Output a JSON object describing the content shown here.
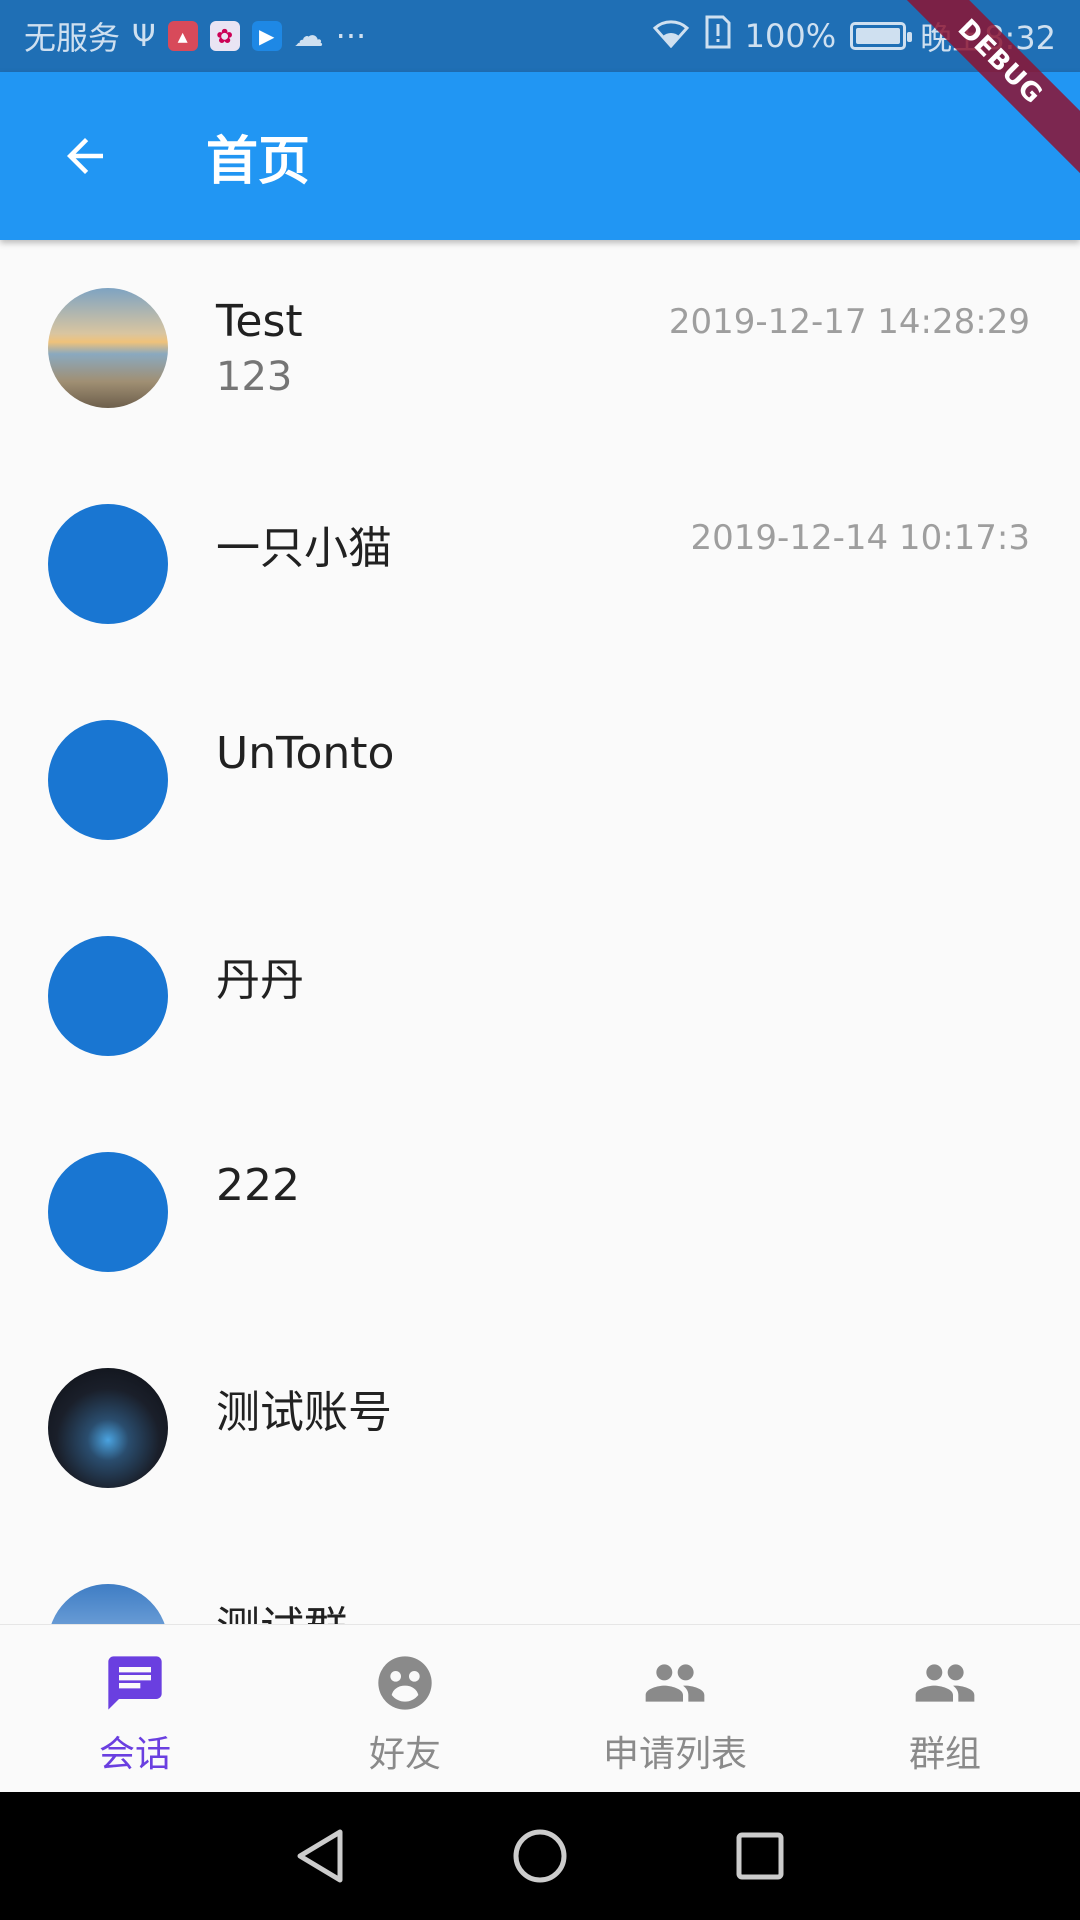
{
  "status_bar": {
    "carrier": "无服务",
    "battery": "100%",
    "battery_level": 1.0,
    "time": "晚上8:32",
    "overflow": "···"
  },
  "app_bar": {
    "title": "首页",
    "back_icon": "arrow-back-icon"
  },
  "debug_banner": "DEBUG",
  "conversations": [
    {
      "name": "Test",
      "message": "123",
      "time": "2019-12-17 14:28:29",
      "avatar": "photo-sunset"
    },
    {
      "name": "一只小猫",
      "message": "",
      "time": "2019-12-14 10:17:3",
      "avatar": "blue-circle"
    },
    {
      "name": "UnTonto",
      "message": "",
      "time": "",
      "avatar": "blue-circle"
    },
    {
      "name": "丹丹",
      "message": "",
      "time": "",
      "avatar": "blue-circle"
    },
    {
      "name": "222",
      "message": "",
      "time": "",
      "avatar": "blue-circle"
    },
    {
      "name": "测试账号",
      "message": "",
      "time": "",
      "avatar": "photo-city-night"
    },
    {
      "name": "测试群",
      "message": "",
      "time": "",
      "avatar": "photo-mountain"
    }
  ],
  "bottom_nav": {
    "active_color": "#6a3fe0",
    "inactive_color": "#8a8a8a",
    "items": [
      {
        "label": "会话",
        "icon": "chat-icon",
        "active": true
      },
      {
        "label": "好友",
        "icon": "face-icon",
        "active": false
      },
      {
        "label": "申请列表",
        "icon": "people-icon",
        "active": false
      },
      {
        "label": "群组",
        "icon": "group-icon",
        "active": false
      }
    ]
  },
  "colors": {
    "app_bar": "#2196f3",
    "status_bar": "#1f6fb5",
    "avatar_blue": "#1976d2"
  }
}
